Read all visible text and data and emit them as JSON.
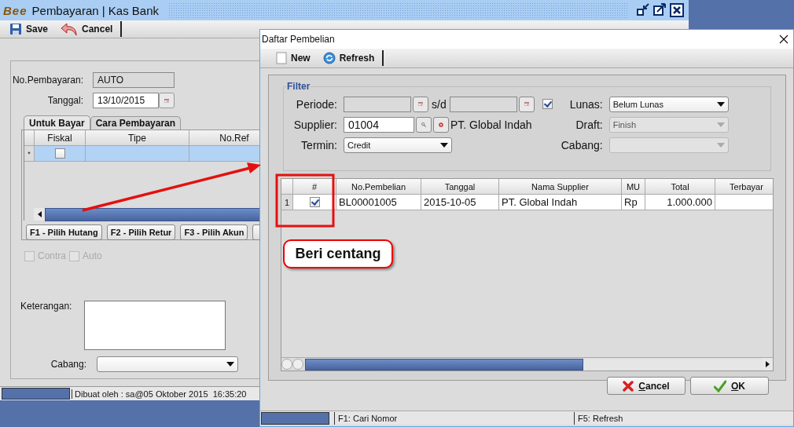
{
  "main_window": {
    "logo": "Bee",
    "title": "Pembayaran | Kas Bank",
    "toolbar": [
      {
        "label": "Save"
      },
      {
        "label": "Cancel"
      }
    ],
    "no_pembayaran": {
      "label": "No.Pembayaran:",
      "value": "AUTO"
    },
    "tanggal": {
      "label": "Tanggal:",
      "value": "13/10/2015"
    },
    "tabs": [
      {
        "label": "Untuk Bayar",
        "selected": true
      },
      {
        "label": "Cara Pembayaran",
        "selected": false
      }
    ],
    "grid": {
      "columns": [
        "Fiskal",
        "Tipe",
        "No.Ref"
      ],
      "rows": [
        {
          "marker": "*",
          "checked": false
        }
      ]
    },
    "buttons": [
      "F1 - Pilih Hutang",
      "F2 - Pilih Retur",
      "F3 - Pilih Akun"
    ],
    "options": [
      {
        "label": "Contra",
        "checked": false,
        "disabled": true
      },
      {
        "label": "Auto",
        "checked": false,
        "disabled": true
      }
    ],
    "keterangan": {
      "label": "Keterangan:"
    },
    "cabang": {
      "label": "Cabang:"
    },
    "status_bar": "Dibuat oleh : sa@05 Oktober 2015  16:35:20"
  },
  "dialog": {
    "title": "Daftar Pembelian",
    "toolbar": [
      {
        "label": "New"
      },
      {
        "label": "Refresh"
      }
    ],
    "filter": {
      "legend": "Filter",
      "periode": {
        "label": "Periode:",
        "separator": "s/d",
        "checked": true
      },
      "supplier": {
        "label": "Supplier:",
        "value": "01004",
        "name": "PT. Global Indah"
      },
      "termin": {
        "label": "Termin:",
        "value": "Credit",
        "disabled": false
      },
      "lunas": {
        "label": "Lunas:",
        "value": "Belum Lunas",
        "disabled": false
      },
      "draft": {
        "label": "Draft:",
        "value": "Finish",
        "disabled": true
      },
      "cabang": {
        "label": "Cabang:",
        "disabled": true
      }
    },
    "table": {
      "columns": [
        "#",
        "No.Pembelian",
        "Tanggal",
        "Nama Supplier",
        "MU",
        "Total",
        "Terbayar"
      ],
      "rows": [
        {
          "index": "1",
          "checked": true,
          "cells": [
            "",
            "BL00001005",
            "2015-10-05",
            "PT. Global Indah",
            "Rp",
            "1.000.000"
          ]
        }
      ]
    },
    "buttons": [
      {
        "label": "Cancel",
        "kind": "cancel"
      },
      {
        "label": "OK",
        "kind": "ok"
      }
    ],
    "status_bar": [
      "F1: Cari Nomor",
      "F5: Refresh"
    ]
  },
  "annotation": {
    "callout": "Beri centang"
  }
}
